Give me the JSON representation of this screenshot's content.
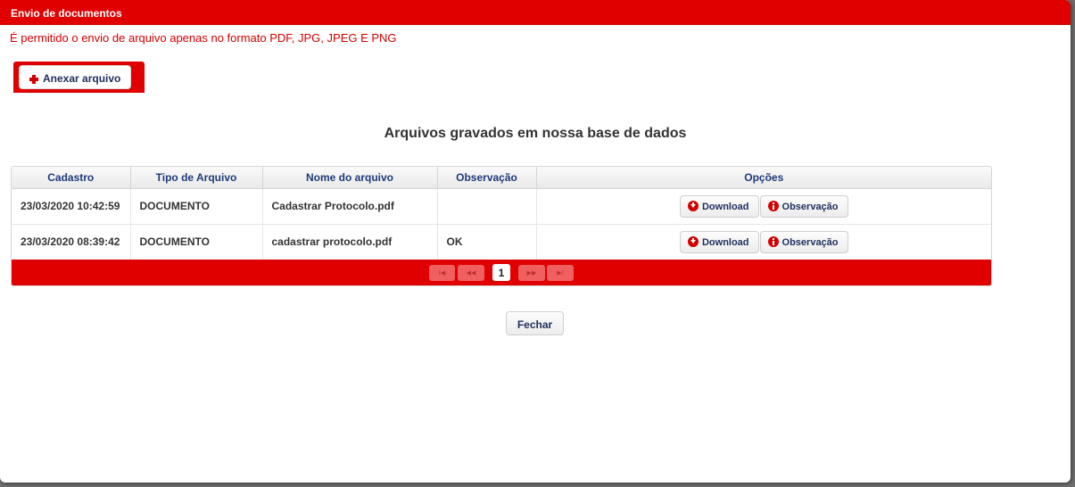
{
  "dialog": {
    "title": "Envio de documentos",
    "notice": "É permitido o envio de arquivo apenas no formato PDF, JPG, JPEG E PNG",
    "attach_label": "Anexar arquivo",
    "section_title": "Arquivos gravados em nossa base de dados",
    "close_label": "Fechar"
  },
  "table": {
    "columns": [
      "Cadastro",
      "Tipo de Arquivo",
      "Nome do arquivo",
      "Observação",
      "Opções"
    ],
    "rows": [
      {
        "cadastro": "23/03/2020 10:42:59",
        "tipo": "DOCUMENTO",
        "nome": "Cadastrar Protocolo.pdf",
        "observacao": "",
        "download_label": "Download",
        "obs_label": "Observação"
      },
      {
        "cadastro": "23/03/2020 08:39:42",
        "tipo": "DOCUMENTO",
        "nome": "cadastrar protocolo.pdf",
        "observacao": "OK",
        "download_label": "Download",
        "obs_label": "Observação"
      }
    ]
  },
  "paginator": {
    "first": "I◀",
    "prev": "◀◀",
    "current_page": "1",
    "next": "▶▶",
    "last": "▶I"
  },
  "colors": {
    "brand_red": "#e00000",
    "header_text": "#1f3a7a"
  }
}
